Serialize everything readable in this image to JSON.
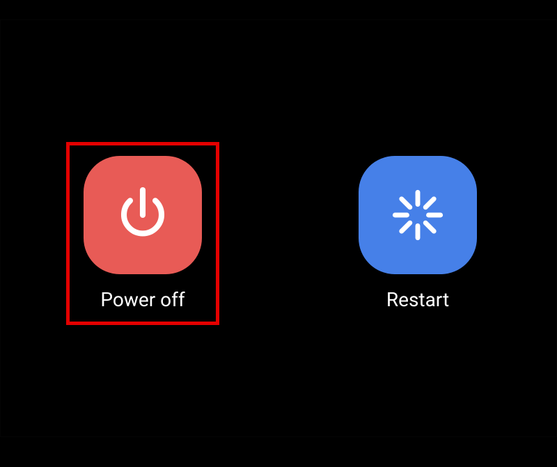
{
  "options": {
    "power_off": {
      "label": "Power off",
      "color": "#e85b56",
      "highlighted": true
    },
    "restart": {
      "label": "Restart",
      "color": "#4680e8",
      "highlighted": false
    }
  }
}
